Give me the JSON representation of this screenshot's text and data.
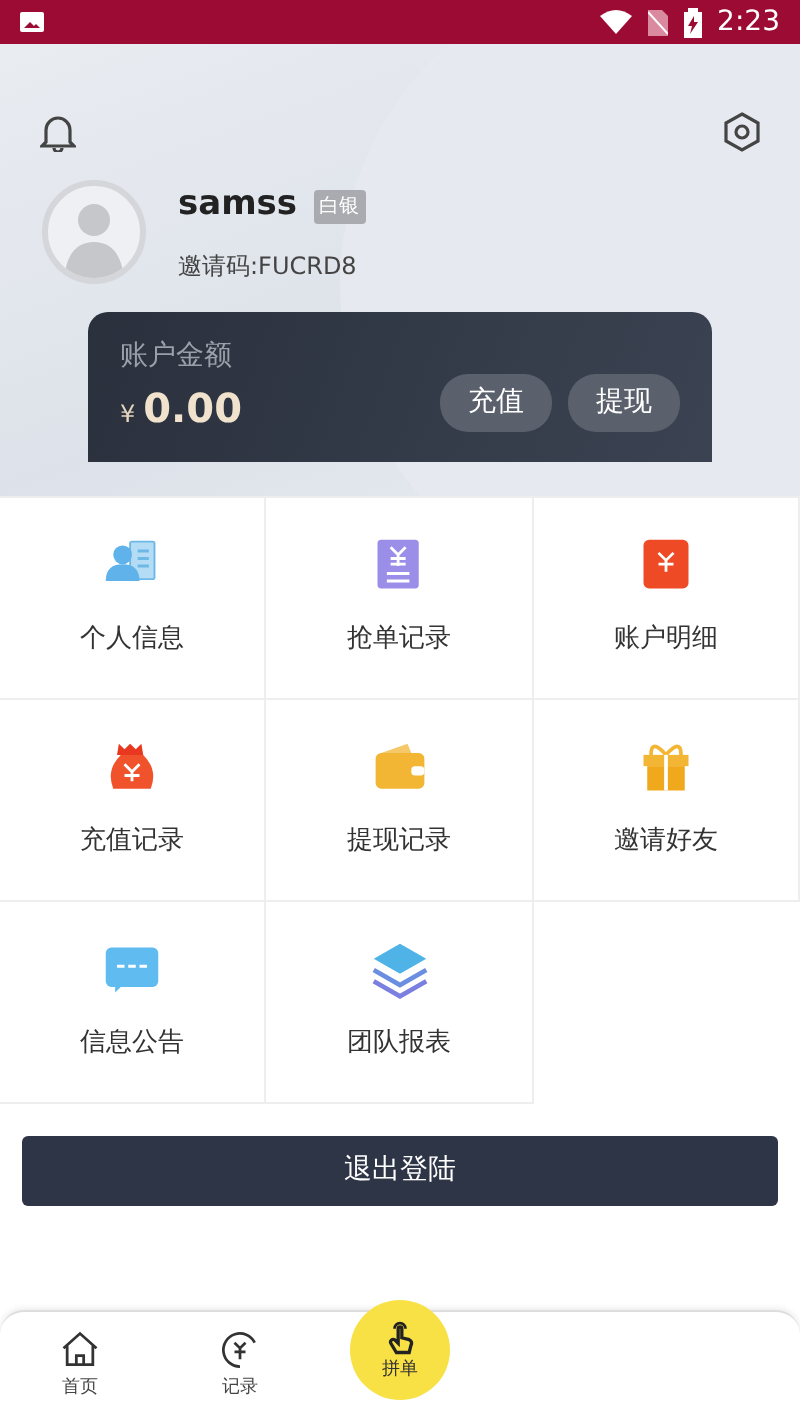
{
  "status_bar": {
    "time": "2:23"
  },
  "profile": {
    "username": "samss",
    "level_badge": "白银",
    "invite_code": "邀请码:FUCRD8"
  },
  "balance": {
    "label": "账户金额",
    "currency": "¥",
    "amount": "0.00",
    "buttons": [
      "充值",
      "提现"
    ]
  },
  "menu": [
    {
      "label": "个人信息",
      "kind": "person-card"
    },
    {
      "label": "抢单记录",
      "kind": "receipt"
    },
    {
      "label": "账户明细",
      "kind": "ledger"
    },
    {
      "label": "充值记录",
      "kind": "money-bag"
    },
    {
      "label": "提现记录",
      "kind": "wallet"
    },
    {
      "label": "邀请好友",
      "kind": "gift"
    },
    {
      "label": "信息公告",
      "kind": "message"
    },
    {
      "label": "团队报表",
      "kind": "layers"
    }
  ],
  "logout_button": "退出登陆",
  "bottom_nav": [
    {
      "label": "首页",
      "kind": "home",
      "selected": false
    },
    {
      "label": "记录",
      "kind": "record",
      "selected": false
    },
    {
      "label": "拼单",
      "kind": "center",
      "selected": false
    }
  ]
}
